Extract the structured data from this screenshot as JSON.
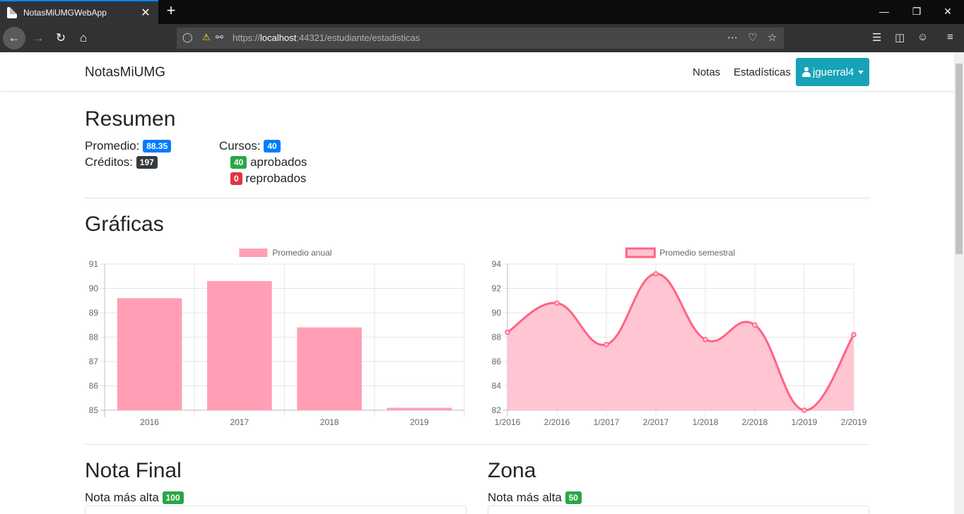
{
  "browser": {
    "tab_title": "NotasMiUMGWebApp",
    "url_host": "localhost",
    "url_rest": ":44321/estudiante/estadisticas",
    "url_scheme": "https://"
  },
  "site": {
    "brand": "NotasMiUMG",
    "nav": {
      "notas": "Notas",
      "estadisticas": "Estadísticas"
    },
    "user": "jguerral4"
  },
  "resumen": {
    "title": "Resumen",
    "promedio_label": "Promedio:",
    "promedio_value": "88.35",
    "creditos_label": "Créditos:",
    "creditos_value": "197",
    "cursos_label": "Cursos:",
    "cursos_value": "40",
    "aprobados_value": "40",
    "aprobados_label": "aprobados",
    "reprobados_value": "0",
    "reprobados_label": "reprobados"
  },
  "graficas": {
    "title": "Gráficas"
  },
  "nota_final": {
    "title": "Nota Final",
    "label": "Nota más alta",
    "value": "100"
  },
  "zona": {
    "title": "Zona",
    "label": "Nota más alta",
    "value": "50"
  },
  "colors": {
    "bar_fill": "#ff9eb5",
    "line_stroke": "#ff6384",
    "line_fill": "#ffc2d1",
    "badge_blue": "#007bff",
    "badge_green": "#28a745",
    "badge_red": "#dc3545",
    "badge_dark": "#343a40",
    "button": "#17a2b8"
  },
  "chart_data": [
    {
      "type": "bar",
      "legend": "Promedio anual",
      "categories": [
        "2016",
        "2017",
        "2018",
        "2019"
      ],
      "values": [
        89.6,
        90.3,
        88.4,
        85.1
      ],
      "ylim": [
        85,
        91
      ],
      "yticks": [
        "85",
        "86",
        "87",
        "88",
        "89",
        "90",
        "91"
      ],
      "grid": true,
      "legend_position": "top"
    },
    {
      "type": "area",
      "legend": "Promedio semestral",
      "categories": [
        "1/2016",
        "2/2016",
        "1/2017",
        "2/2017",
        "1/2018",
        "2/2018",
        "1/2019",
        "2/2019"
      ],
      "values": [
        88.4,
        90.8,
        87.4,
        93.2,
        87.8,
        89.0,
        82.0,
        88.2
      ],
      "ylim": [
        82,
        94
      ],
      "yticks": [
        "82",
        "84",
        "86",
        "88",
        "90",
        "92",
        "94"
      ],
      "grid": true,
      "legend_position": "top"
    }
  ]
}
